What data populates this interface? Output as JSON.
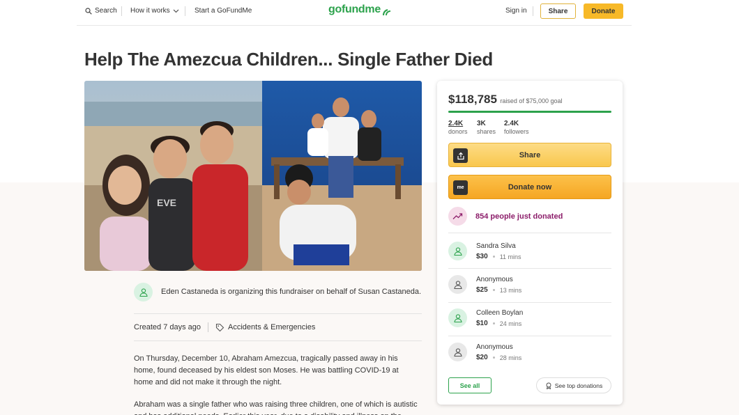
{
  "header": {
    "search_label": "Search",
    "how_it_works_label": "How it works",
    "start_label": "Start a GoFundMe",
    "logo_text": "gofundme",
    "sign_in_label": "Sign in",
    "share_label": "Share",
    "donate_label": "Donate"
  },
  "campaign": {
    "title": "Help The Amezcua Children... Single Father Died",
    "organizer_text": "Eden Castaneda is organizing this fundraiser on behalf of Susan Castaneda.",
    "created": "Created 7 days ago",
    "category": "Accidents & Emergencies",
    "story": [
      "On Thursday, December 10, Abraham Amezcua, tragically passed away in his home, found deceased by his eldest son Moses. He was battling COVID-19 at home and did not make it through the night.",
      "Abraham was a single father who was raising three children, one of which is autistic and has additional needs. Earlier this year, due to a disability and illness on the"
    ]
  },
  "donation_card": {
    "raised_amount": "$118,785",
    "goal_text": "raised of $75,000 goal",
    "progress_fraction": 1.0,
    "stats": [
      {
        "number": "2.4K",
        "label": "donors"
      },
      {
        "number": "3K",
        "label": "shares"
      },
      {
        "number": "2.4K",
        "label": "followers"
      }
    ],
    "share_label": "Share",
    "donate_label": "Donate now",
    "donate_icon_text": "me",
    "just_donated": "854 people just donated",
    "donors": [
      {
        "name": "Sandra Silva",
        "amount": "$30",
        "time": "11 mins",
        "avatar": "green"
      },
      {
        "name": "Anonymous",
        "amount": "$25",
        "time": "13 mins",
        "avatar": "gray"
      },
      {
        "name": "Colleen Boylan",
        "amount": "$10",
        "time": "24 mins",
        "avatar": "green"
      },
      {
        "name": "Anonymous",
        "amount": "$20",
        "time": "28 mins",
        "avatar": "gray"
      }
    ],
    "see_all_label": "See all",
    "top_donations_label": "See top donations"
  },
  "colors": {
    "brand_green": "#2ca24c",
    "donate_orange": "#f5a623",
    "just_donated_purple": "#8c1d6a"
  }
}
